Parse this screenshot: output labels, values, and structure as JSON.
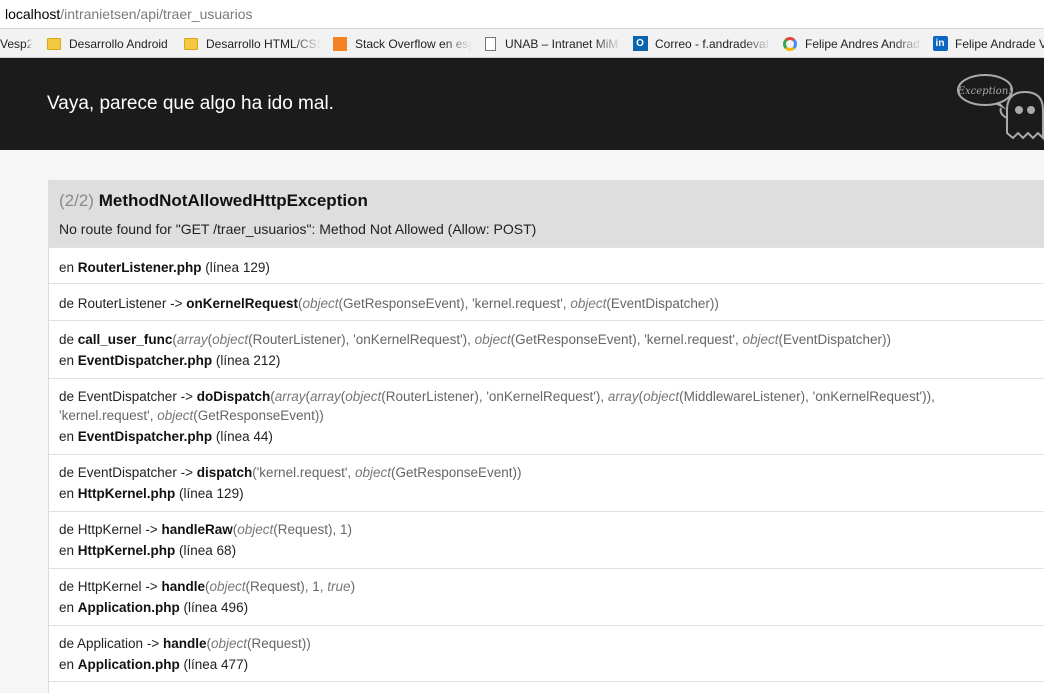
{
  "browser": {
    "url_host": "localhost",
    "url_path": "/intranietsen/api/traer_usuarios",
    "bookmarks": [
      {
        "label": "Vesp2",
        "icon": "page-icon"
      },
      {
        "label": "Desarrollo Android",
        "icon": "folder-icon"
      },
      {
        "label": "Desarrollo HTML/CSS",
        "icon": "folder-icon"
      },
      {
        "label": "Stack Overflow en esp",
        "icon": "stackoverflow-icon"
      },
      {
        "label": "UNAB – Intranet MiM",
        "icon": "document-icon"
      },
      {
        "label": "Correo - f.andradeval",
        "icon": "outlook-icon"
      },
      {
        "label": "Felipe Andres Andrad",
        "icon": "profile-ring-icon"
      },
      {
        "label": "Felipe Andrade V",
        "icon": "linkedin-icon"
      }
    ]
  },
  "header": {
    "title": "Vaya, parece que algo ha ido mal.",
    "logo_text": "Exception!"
  },
  "exception": {
    "count": "(2/2)",
    "class": "MethodNotAllowedHttpException",
    "message": "No route found for \"GET /traer_usuarios\": Method Not Allowed (Allow: POST)"
  },
  "trace": {
    "t1": {
      "pre": "en ",
      "file": "RouterListener.php",
      "post": " (línea 129)"
    },
    "t2": {
      "pre": "de RouterListener",
      "arrow": " -> ",
      "fn": "onKernelRequest",
      "args_a": "(",
      "obj1": "object",
      "arg1": "(GetResponseEvent), 'kernel.request', ",
      "obj2": "object",
      "arg2": "(EventDispatcher))"
    },
    "t3": {
      "pre": "de  ",
      "fn": "call_user_func",
      "args_a": "(",
      "arr1": "array",
      "a1": "(",
      "obj1": "object",
      "a2": "(RouterListener), 'onKernelRequest'), ",
      "obj2": "object",
      "a3": "(GetResponseEvent), 'kernel.request', ",
      "obj3": "object",
      "a4": "(EventDispatcher))",
      "loc_pre": "en ",
      "loc_file": "EventDispatcher.php",
      "loc_post": " (línea 212)"
    },
    "t4": {
      "pre": "de EventDispatcher",
      "arrow": " -> ",
      "fn": "doDispatch",
      "args_a": "(",
      "arr1": "array",
      "a1": "(",
      "arr2": "array",
      "a2": "(",
      "obj1": "object",
      "a3": "(RouterListener), 'onKernelRequest'), ",
      "arr3": "array",
      "a4": "(",
      "obj2": "object",
      "a5": "(MiddlewareListener), 'onKernelRequest')),",
      "l2a": "'kernel.request', ",
      "obj3": "object",
      "l2b": "(GetResponseEvent))",
      "loc_pre": "en ",
      "loc_file": "EventDispatcher.php",
      "loc_post": " (línea 44)"
    },
    "t5": {
      "pre": "de EventDispatcher",
      "arrow": " -> ",
      "fn": "dispatch",
      "args_a": "('kernel.request', ",
      "obj1": "object",
      "a1": "(GetResponseEvent))",
      "loc_pre": "en ",
      "loc_file": "HttpKernel.php",
      "loc_post": " (línea 129)"
    },
    "t6": {
      "pre": "de HttpKernel",
      "arrow": " -> ",
      "fn": "handleRaw",
      "args_a": "(",
      "obj1": "object",
      "a1": "(Request), 1)",
      "loc_pre": "en ",
      "loc_file": "HttpKernel.php",
      "loc_post": " (línea 68)"
    },
    "t7": {
      "pre": "de HttpKernel",
      "arrow": " -> ",
      "fn": "handle",
      "args_a": "(",
      "obj1": "object",
      "a1": "(Request), 1, ",
      "bool": "true",
      "a2": ")",
      "loc_pre": "en ",
      "loc_file": "Application.php",
      "loc_post": " (línea 496)"
    },
    "t8": {
      "pre": "de Application",
      "arrow": " -> ",
      "fn": "handle",
      "args_a": "(",
      "obj1": "object",
      "a1": "(Request))",
      "loc_pre": "en ",
      "loc_file": "Application.php",
      "loc_post": " (línea 477)"
    }
  }
}
